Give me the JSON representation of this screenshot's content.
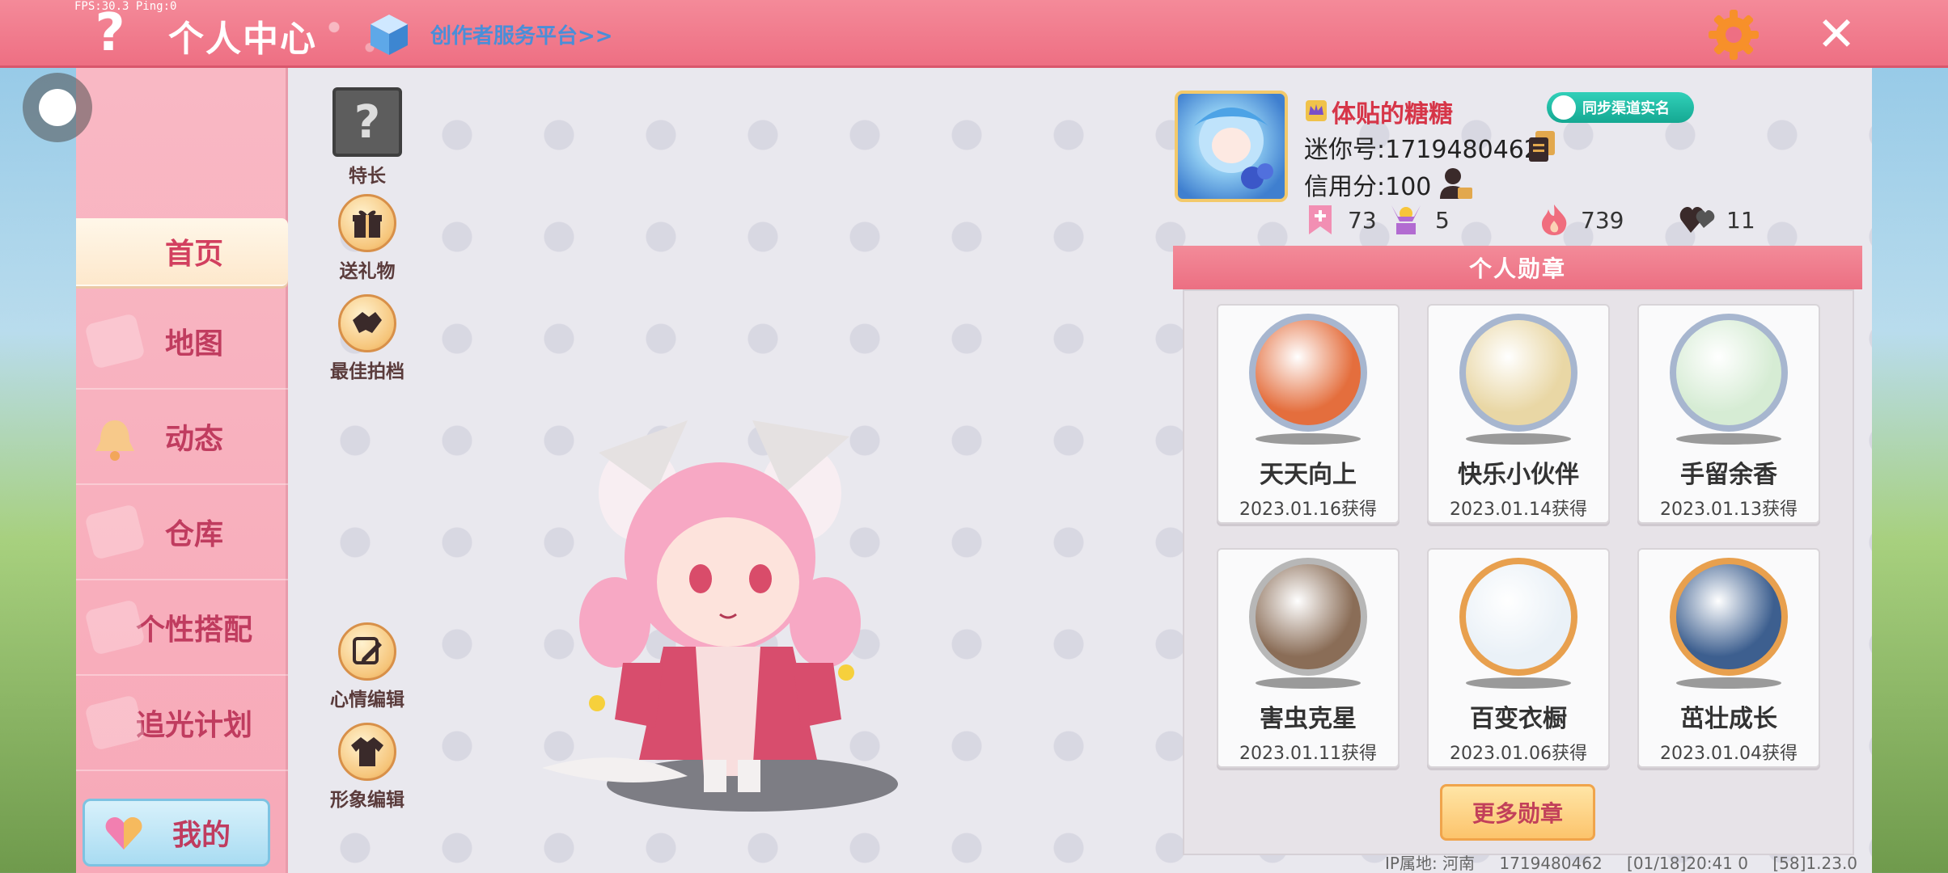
{
  "debug": {
    "fps": "FPS:30.3  Ping:0"
  },
  "header": {
    "help_icon": "?",
    "title": "个人中心",
    "creator_link": "创作者服务平台>>",
    "close_icon": "✕"
  },
  "sidebar": {
    "items": [
      {
        "label": "首页",
        "active": true
      },
      {
        "label": "地图"
      },
      {
        "label": "动态"
      },
      {
        "label": "仓库"
      },
      {
        "label": "个性搭配"
      },
      {
        "label": "追光计划"
      }
    ],
    "mine_label": "我的"
  },
  "actions": {
    "special": "特长",
    "special_icon": "?",
    "gift": "送礼物",
    "partner": "最佳拍档",
    "mood": "心情编辑",
    "appearance": "形象编辑"
  },
  "profile": {
    "username": "体贴的糖糖",
    "sync_label": "同步渠道实名",
    "mini_id": "迷你号:1719480462",
    "credit": "信用分:100",
    "stats": {
      "flag_count": "73",
      "cheer_count": "5",
      "fire_count": "739",
      "heart_count": "11"
    }
  },
  "badges": {
    "title": "个人勋章",
    "items": [
      {
        "name": "天天向上",
        "date": "2023.01.16获得",
        "ring": "#a7b6cf",
        "fill": "#e46e3d"
      },
      {
        "name": "快乐小伙伴",
        "date": "2023.01.14获得",
        "ring": "#a7b6cf",
        "fill": "#e9d7a5"
      },
      {
        "name": "手留余香",
        "date": "2023.01.13获得",
        "ring": "#a7b6cf",
        "fill": "#d6ecd4"
      },
      {
        "name": "害虫克星",
        "date": "2023.01.11获得",
        "ring": "#b7b7b7",
        "fill": "#8a6d57"
      },
      {
        "name": "百变衣橱",
        "date": "2023.01.06获得",
        "ring": "#e8a04e",
        "fill": "#eaf1f7"
      },
      {
        "name": "茁壮成长",
        "date": "2023.01.04获得",
        "ring": "#e8a04e",
        "fill": "#3d5f8f"
      }
    ],
    "more_label": "更多勋章"
  },
  "footer": {
    "ip": "IP属地: 河南",
    "uid": "1719480462",
    "timestamp": "[01/18]20:41 0",
    "version": "[58]1.23.0"
  },
  "colors": {
    "topbar": "#ee6f83",
    "sidebar": "#f7a9b8",
    "accent_text": "#c03c5f",
    "link": "#4a8ed8",
    "sync": "#15a892"
  }
}
